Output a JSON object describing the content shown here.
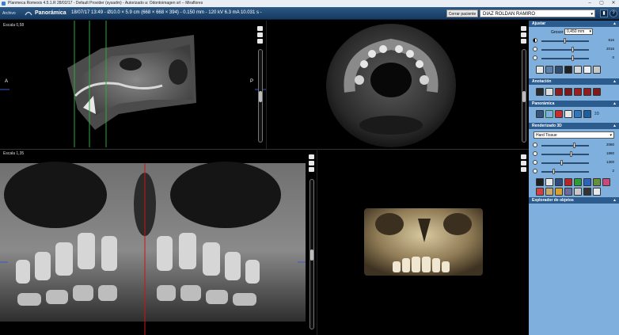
{
  "window": {
    "title": "Planmeca Romexis 4.5.1.R  28/02/17 - Default Provider (sysadm) - Autorizado a: Odontoimagen srl -- Miraflores",
    "controls": [
      "–",
      "▢",
      "✕"
    ]
  },
  "toolbar": {
    "menu_label": "Archivo",
    "mode_label": "Panorámica",
    "study_info": "18/07/17 13:49 - Ø10.0 × 5.9 cm (668 × 668 × 394) - 0.150 mm - 120 kV 6.3 mA 10.031 s -",
    "close_patient_label": "Cerrar paciente",
    "patient_name": "DIAZ ROLDAN RAMIRO",
    "patient_dropdown": "▾",
    "layout_button": "▮",
    "help_button": "?"
  },
  "viewports": {
    "sagittal": {
      "scale": "Escala 0,58",
      "left_label": "A",
      "right_label": "P"
    },
    "panoramic": {
      "scale": "Escala 1,35"
    }
  },
  "panel": {
    "collapse_glyph": "▲",
    "ajustar": {
      "title": "Ajustar",
      "grosor_label": "Grosor",
      "grosor_value": "0,450 mm",
      "grosor_dropdown": "▾",
      "brightness": "816",
      "contrast": "2016",
      "gamma": "0"
    },
    "anotacion": {
      "title": "Anotación"
    },
    "panoramica": {
      "title": "Panorámica",
      "3d_label": "3D"
    },
    "renderizado": {
      "title": "Renderizado 3D",
      "preset": "Hard Tissue",
      "preset_dropdown": "▾",
      "val1": "2080",
      "val2": "1880",
      "val3": "1300",
      "val4": "2"
    },
    "explorador": {
      "title": "Explorador de objetos"
    }
  },
  "colors": {
    "toolbar": "#1f4570",
    "panel_bg": "#7fb0dd",
    "panel_header": "#2c5c8e",
    "reference_line_red": "#c81414",
    "reference_line_green": "#2fa73a"
  }
}
